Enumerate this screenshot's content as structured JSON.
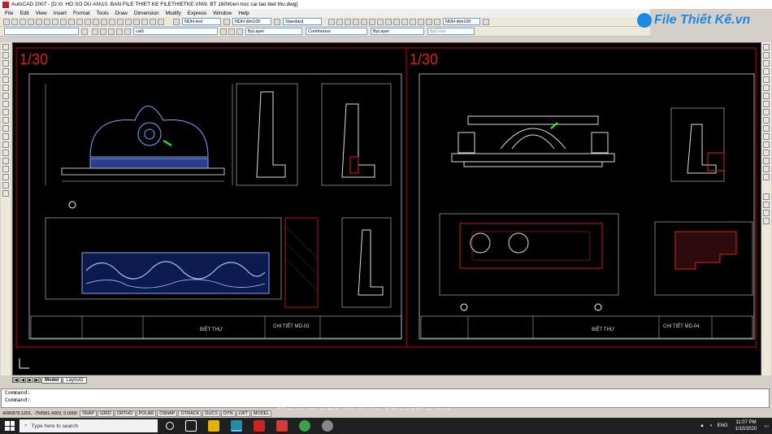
{
  "window": {
    "title": "AutoCAD 2007 - [D:\\0. HO SO DU AN\\10. BAN FILE THIET KE FILETHIETKE.VN\\9. BT 160\\Kien truc cai tao biet thu.dwg]"
  },
  "menu": [
    "File",
    "Edit",
    "View",
    "Insert",
    "Format",
    "Tools",
    "Draw",
    "Dimension",
    "Modify",
    "Express",
    "Window",
    "Help"
  ],
  "toolbar": {
    "text_style": "NDH text",
    "dim_style": "NDH dim100",
    "table_style": "Standard",
    "dim_style_2": "NDH dim100",
    "layer": "cat1",
    "color": "ByLayer",
    "linetype": "Continuous",
    "lineweight": "ByLayer",
    "plot_style": "ByColor"
  },
  "brand": {
    "logo_text": "File Thiết Kế.vn"
  },
  "drawing": {
    "scale_left": "1/30",
    "scale_right": "1/30",
    "sheet_left": {
      "title": "BIỆT THỰ",
      "detail": "CHI TIẾT MD-03"
    },
    "sheet_right": {
      "title": "BIỆT THỰ",
      "detail": "CHI TIẾT MD-04"
    }
  },
  "tabs": [
    "Model",
    "Layout2"
  ],
  "command": [
    "Command:",
    "Command:"
  ],
  "status": {
    "coords": "4280878.1201, -758581.4303, 0.0000",
    "toggles": [
      "SNAP",
      "GRID",
      "ORTHO",
      "POLAR",
      "OSNAP",
      "OTRACK",
      "DUCS",
      "DYN",
      "LWT",
      "MODEL"
    ]
  },
  "taskbar": {
    "search_placeholder": "Type here to search",
    "lang": "ENG",
    "time": "11:07 PM",
    "date": "1/10/2020"
  },
  "watermark": "Copyright © FileThietKe.vn"
}
